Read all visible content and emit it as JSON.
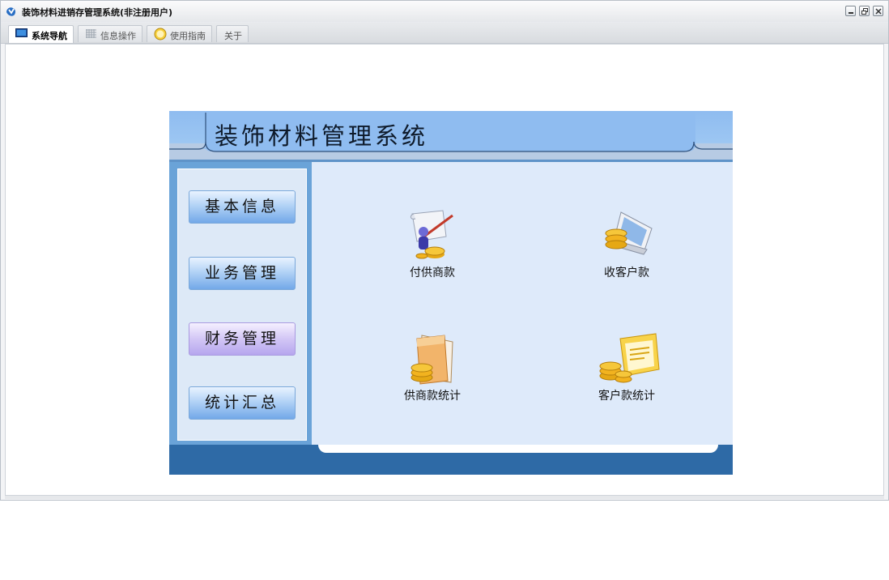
{
  "window": {
    "title": "装饰材料进销存管理系统(非注册用户)",
    "app_icon": "app-logo-icon",
    "controls": [
      "minimize",
      "restore",
      "close"
    ]
  },
  "tabs": [
    {
      "label": "系统导航",
      "icon": "monitor-icon",
      "active": true
    },
    {
      "label": "信息操作",
      "icon": "grid-icon",
      "active": false
    },
    {
      "label": "使用指南",
      "icon": "help-icon",
      "active": false
    },
    {
      "label": "关于",
      "icon": "",
      "active": false
    }
  ],
  "panel": {
    "system_name": "装饰材料管理系统"
  },
  "sidebar": {
    "items": [
      {
        "label": "基本信息",
        "active": false
      },
      {
        "label": "业务管理",
        "active": false
      },
      {
        "label": "财务管理",
        "active": true
      },
      {
        "label": "统计汇总",
        "active": false
      }
    ]
  },
  "functions": [
    {
      "label": "付供商款",
      "icon": "supplier-payment-icon"
    },
    {
      "label": "收客户款",
      "icon": "customer-receipt-icon"
    },
    {
      "label": "供商款统计",
      "icon": "supplier-stats-icon"
    },
    {
      "label": "客户款统计",
      "icon": "customer-stats-icon"
    }
  ],
  "colors": {
    "header_blue": "#8fbcf0",
    "sidebar_blue": "#6aa3d8",
    "footer_blue": "#2e6aa6",
    "main_bg": "#deeafa",
    "active_nav": "#d2c6f5",
    "coin_gold": "#f2b31f"
  }
}
